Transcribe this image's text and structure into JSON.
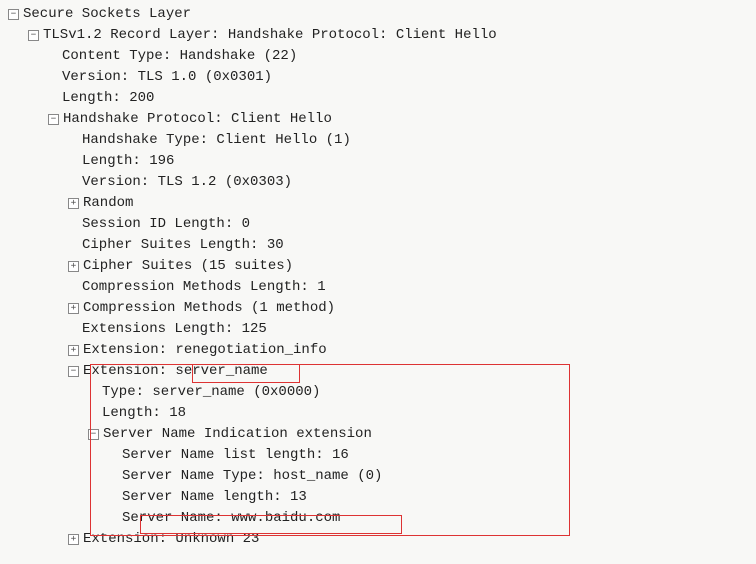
{
  "tree": {
    "root": {
      "label": "Secure Sockets Layer",
      "record": {
        "label": "TLSv1.2 Record Layer: Handshake Protocol: Client Hello",
        "content_type": "Content Type: Handshake (22)",
        "version": "Version: TLS 1.0 (0x0301)",
        "length": "Length: 200",
        "handshake": {
          "label": "Handshake Protocol: Client Hello",
          "type": "Handshake Type: Client Hello (1)",
          "length": "Length: 196",
          "version": "Version: TLS 1.2 (0x0303)",
          "random": "Random",
          "session_id_len": "Session ID Length: 0",
          "cipher_len": "Cipher Suites Length: 30",
          "cipher_suites": "Cipher Suites (15 suites)",
          "comp_len": "Compression Methods Length: 1",
          "comp_methods": "Compression Methods (1 method)",
          "ext_len": "Extensions Length: 125",
          "ext_reneg": "Extension: renegotiation_info",
          "ext_sni": {
            "label_prefix": "Extension: ",
            "label_name": "server_name",
            "type": "Type: server_name (0x0000)",
            "length": "Length: 18",
            "sni_ext": {
              "label": "Server Name Indication extension",
              "list_len": "Server Name list length: 16",
              "name_type": "Server Name Type: host_name (0)",
              "name_len": "Server Name length: 13",
              "name_value": "Server Name: www.baidu.com"
            }
          },
          "ext_unknown": "Extension: Unknown 23"
        }
      }
    }
  },
  "toggles": {
    "minus": "−",
    "plus": "+"
  }
}
